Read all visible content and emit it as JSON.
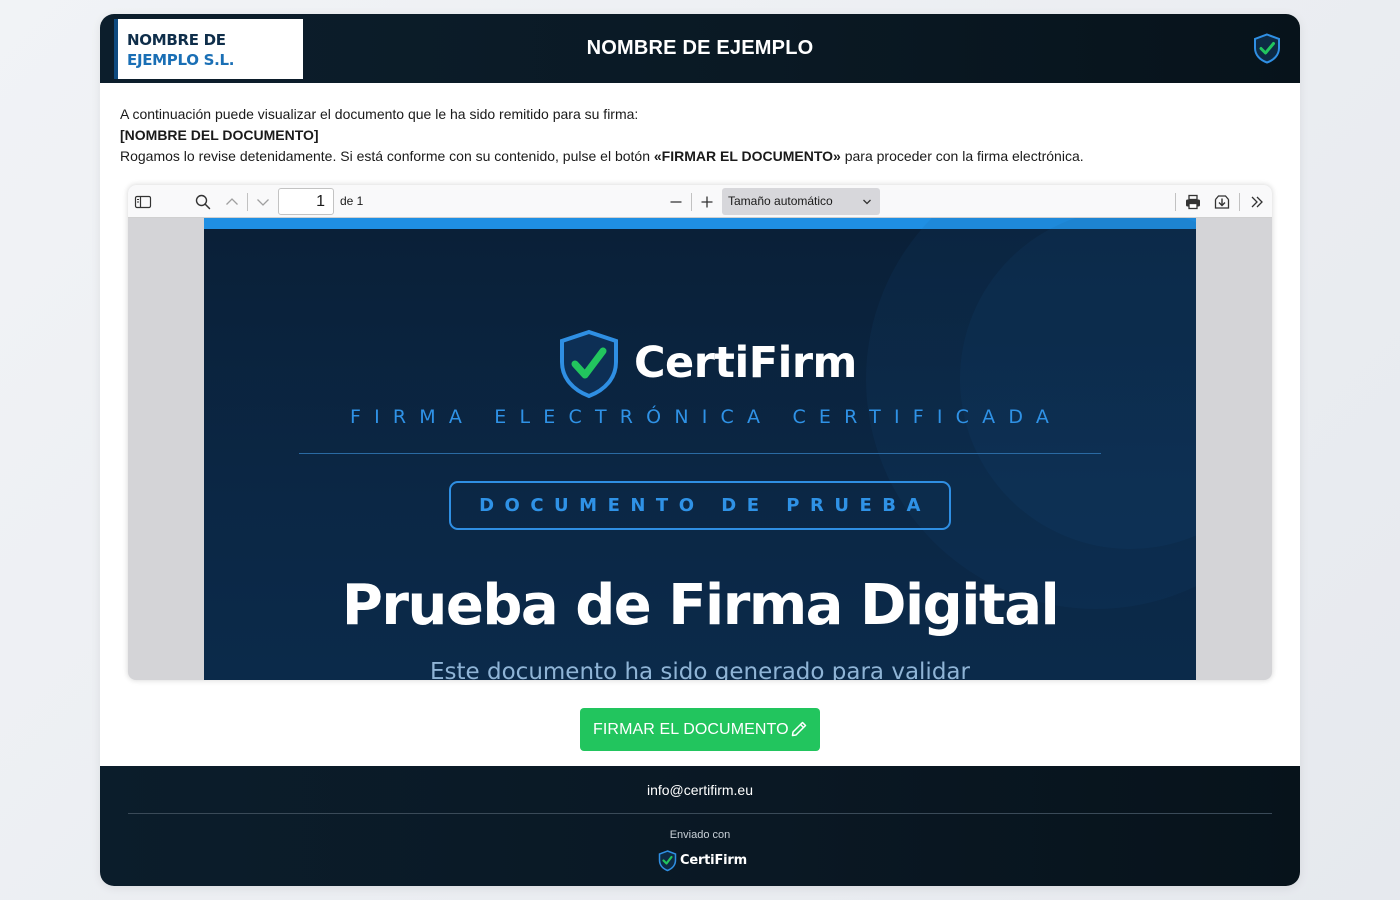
{
  "header": {
    "logo_line1": "NOMBRE DE",
    "logo_line2": "EJEMPLO S.L.",
    "title": "NOMBRE DE EJEMPLO"
  },
  "intro": {
    "line1": "A continuación puede visualizar el documento que le ha sido remitido para su firma:",
    "doc_name": "[NOMBRE DEL DOCUMENTO]",
    "line3_pre": "Rogamos lo revise detenidamente. Si está conforme con su contenido, pulse el botón ",
    "line3_bold": "«FIRMAR EL DOCUMENTO»",
    "line3_post": " para proceder con la firma electrónica."
  },
  "viewer": {
    "page_number": "1",
    "page_of": "de 1",
    "zoom_label": "Tamaño automático",
    "document": {
      "brand": "CertiFirm",
      "tagline": "FIRMA ELECTRÓNICA CERTIFICADA",
      "badge": "DOCUMENTO DE PRUEBA",
      "title": "Prueba de Firma Digital",
      "subtitle": "Este documento ha sido generado para validar"
    }
  },
  "sign_button": {
    "label": "FIRMAR EL DOCUMENTO"
  },
  "footer": {
    "email": "info@certifirm.eu",
    "sent_with": "Enviado con",
    "brand": "CertiFirm"
  },
  "colors": {
    "header_bg": "#0c1e2c",
    "accent_blue": "#2f92e6",
    "sign_green": "#22c55e",
    "check_green": "#22c55e"
  },
  "icons": [
    "shield-check-icon",
    "sidebar-toggle-icon",
    "search-icon",
    "chevron-up-icon",
    "chevron-down-icon",
    "zoom-out-icon",
    "zoom-in-icon",
    "print-icon",
    "download-icon",
    "double-chevron-right-icon",
    "pencil-icon"
  ]
}
